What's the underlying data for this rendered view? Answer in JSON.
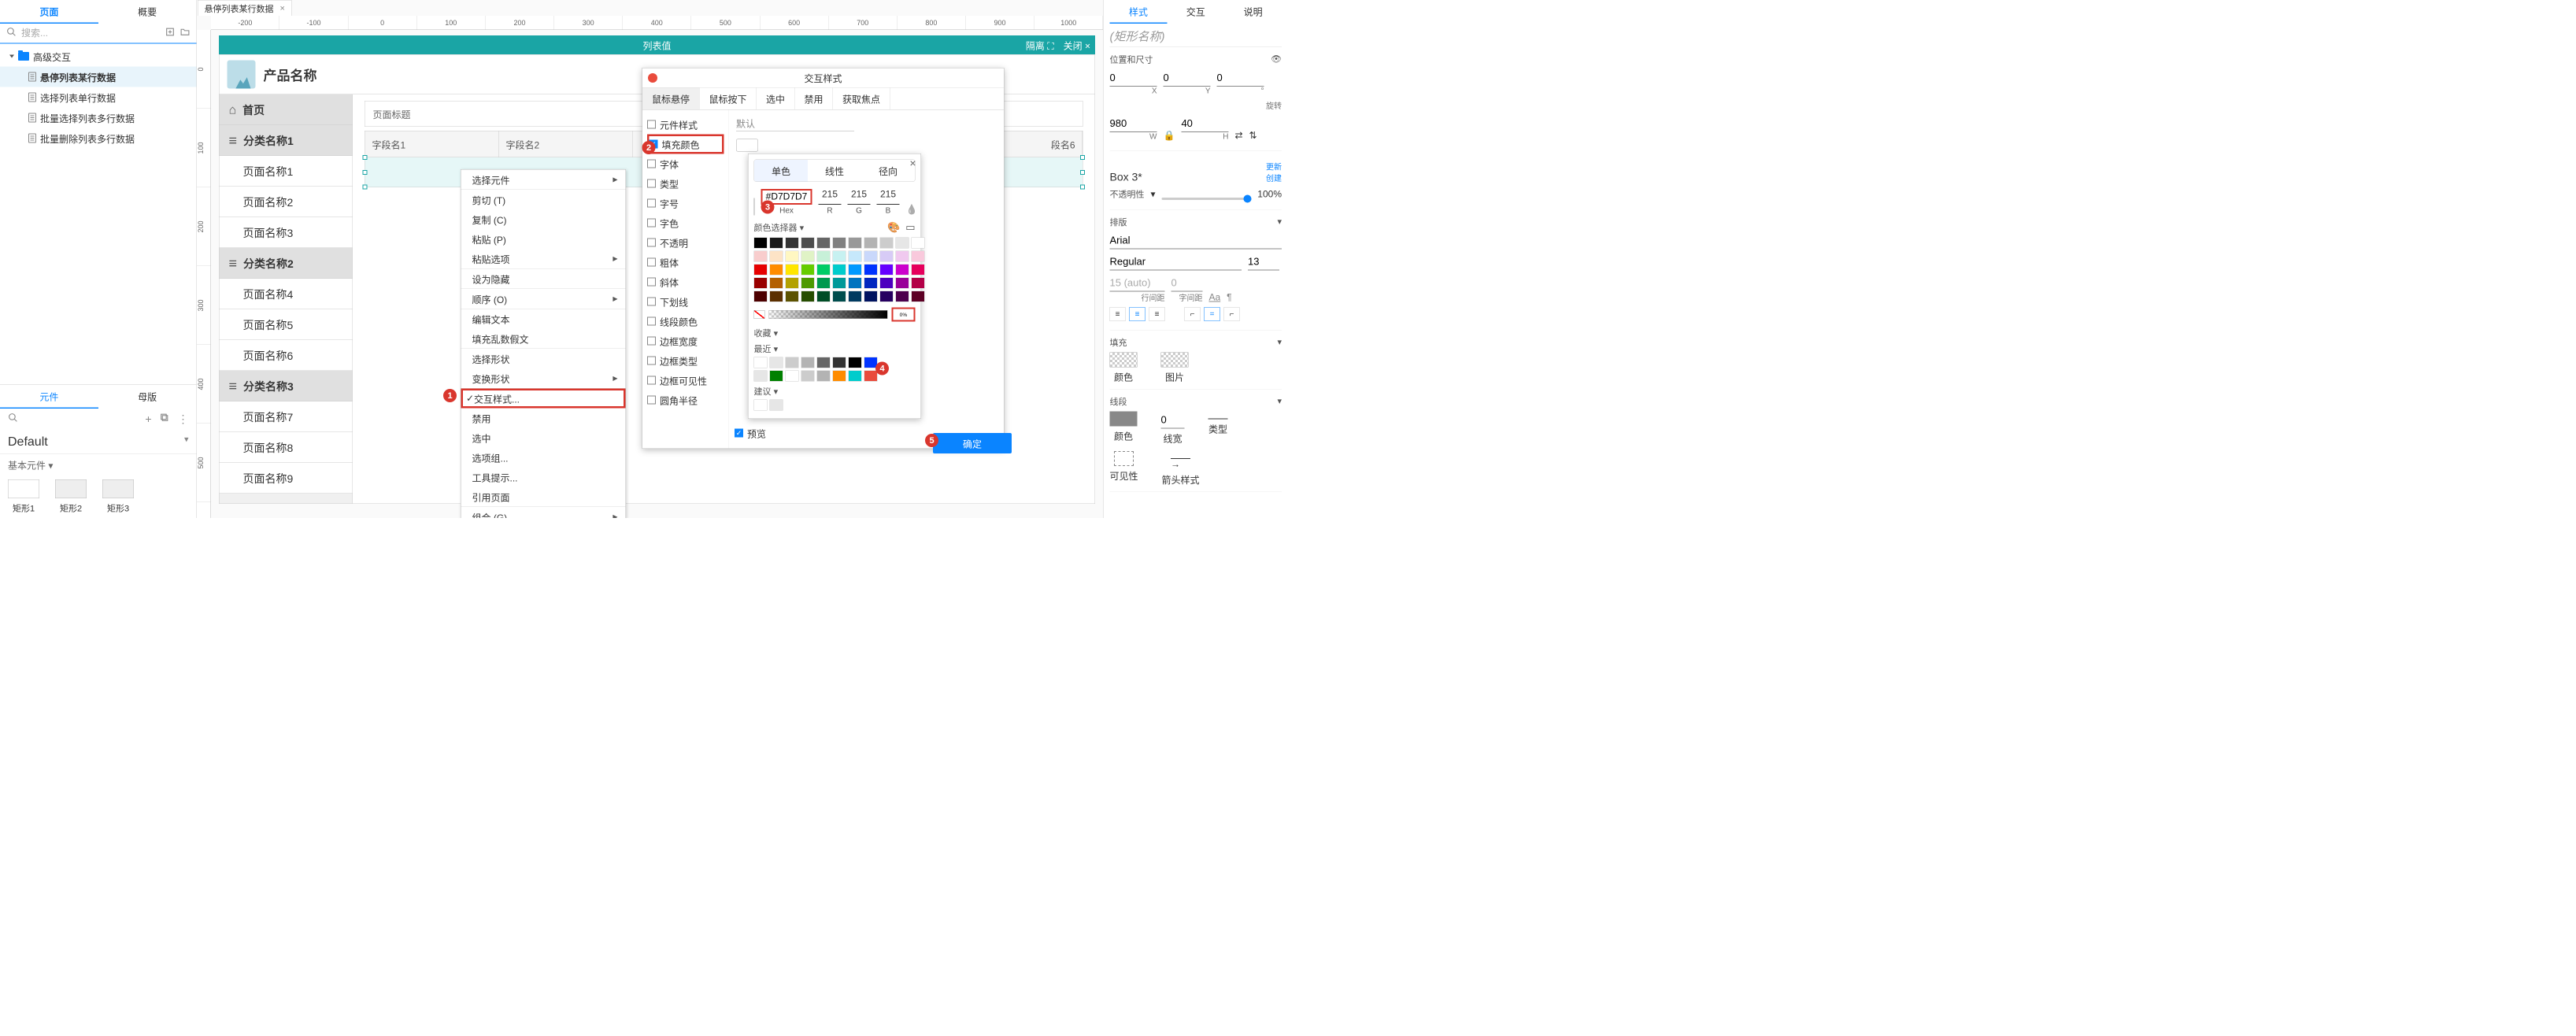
{
  "left": {
    "tabs": [
      "页面",
      "概要"
    ],
    "search_placeholder": "搜索...",
    "tree_root": "高级交互",
    "tree_items": [
      "悬停列表某行数据",
      "选择列表单行数据",
      "批量选择列表多行数据",
      "批量删除列表多行数据"
    ],
    "bot_tabs": [
      "元件",
      "母版"
    ],
    "default": "Default",
    "basic_section": "基本元件",
    "shapes": [
      "矩形1",
      "矩形2",
      "矩形3"
    ]
  },
  "canvas": {
    "doc_tab": "悬停列表某行数据",
    "ruler_h": [
      "-200",
      "-100",
      "0",
      "100",
      "200",
      "300",
      "400",
      "500",
      "600",
      "700",
      "800",
      "900",
      "1000"
    ],
    "ruler_v": [
      "0",
      "100",
      "200",
      "300",
      "400",
      "500"
    ],
    "title": "列表值",
    "isolate": "隔离",
    "close": "关闭",
    "product": "产品名称",
    "side": [
      "首页",
      "分类名称1",
      "页面名称1",
      "页面名称2",
      "页面名称3",
      "分类名称2",
      "页面名称4",
      "页面名称5",
      "页面名称6",
      "分类名称3",
      "页面名称7",
      "页面名称8",
      "页面名称9"
    ],
    "side_cat_idx": [
      0,
      1,
      5,
      9
    ],
    "main_title": "页面标题",
    "cols": [
      "字段名1",
      "字段名2",
      "段名6"
    ]
  },
  "ctx": [
    {
      "t": "选择元件",
      "sub": true
    },
    {
      "sep": true
    },
    {
      "t": "剪切 (T)"
    },
    {
      "t": "复制 (C)"
    },
    {
      "t": "粘贴 (P)"
    },
    {
      "t": "粘贴选项",
      "sub": true
    },
    {
      "sep": true
    },
    {
      "t": "设为隐藏"
    },
    {
      "sep": true
    },
    {
      "t": "顺序 (O)",
      "sub": true
    },
    {
      "sep": true
    },
    {
      "t": "编辑文本"
    },
    {
      "t": "填充乱数假文"
    },
    {
      "sep": true
    },
    {
      "t": "选择形状"
    },
    {
      "t": "变换形状",
      "sub": true
    },
    {
      "sep": true
    },
    {
      "t": "交互样式...",
      "check": true,
      "hl": true
    },
    {
      "t": "禁用"
    },
    {
      "t": "选中"
    },
    {
      "t": "选项组..."
    },
    {
      "t": "工具提示..."
    },
    {
      "t": "引用页面"
    },
    {
      "sep": true
    },
    {
      "t": "组合 (G)",
      "sub": true
    }
  ],
  "ixdlg": {
    "title": "交互样式",
    "tabs": [
      "鼠标悬停",
      "鼠标按下",
      "选中",
      "禁用",
      "获取焦点"
    ],
    "opts": [
      "元件样式",
      "填充颜色",
      "字体",
      "类型",
      "字号",
      "字色",
      "不透明",
      "粗体",
      "斜体",
      "下划线",
      "线段颜色",
      "边框宽度",
      "边框类型",
      "边框可见性",
      "圆角半径"
    ],
    "checked_idx": 1,
    "default": "默认",
    "preview": "预览",
    "ok": "确定"
  },
  "cpk": {
    "tabs": [
      "单色",
      "线性",
      "径向"
    ],
    "hex": "#D7D7D7",
    "r": "215",
    "g": "215",
    "b": "215",
    "hex_l": "Hex",
    "r_l": "R",
    "g_l": "G",
    "b_l": "B",
    "picker": "颜色选择器",
    "opacity": "0%",
    "fav": "收藏",
    "recent": "最近",
    "suggest": "建议",
    "grays": [
      "#000000",
      "#1a1a1a",
      "#333333",
      "#4d4d4d",
      "#666666",
      "#808080",
      "#999999",
      "#b3b3b3",
      "#cccccc",
      "#e6e6e6",
      "#ffffff"
    ],
    "row1": [
      "#f8cdcd",
      "#fde3c6",
      "#fff7c2",
      "#e0f3c6",
      "#c7f0d8",
      "#c7f1f1",
      "#c6e8fb",
      "#c9d8fb",
      "#d7cbf6",
      "#f0c9ef",
      "#f9c9dc"
    ],
    "row2": [
      "#e60000",
      "#ff8c00",
      "#ffe600",
      "#66cc00",
      "#00cc66",
      "#00cccc",
      "#0099ff",
      "#0033ff",
      "#6600ff",
      "#cc00cc",
      "#e6005c"
    ],
    "row3": [
      "#990000",
      "#b35f00",
      "#b3a100",
      "#4d9900",
      "#00994d",
      "#009999",
      "#0073bf",
      "#0026bf",
      "#4d00bf",
      "#990099",
      "#b30047"
    ],
    "row4": [
      "#4d0000",
      "#5c3000",
      "#5c5200",
      "#264d00",
      "#004d26",
      "#004d4d",
      "#003a60",
      "#001360",
      "#260060",
      "#4d004d",
      "#5c0024"
    ],
    "recent_c": [
      "#ffffff",
      "#e6e6e6",
      "#cccccc",
      "#b3b3b3",
      "#666666",
      "#333333",
      "#000000",
      "#0033ff"
    ],
    "recent_c2": [
      "#e6e6e6",
      "#008000",
      "#ffffff",
      "#cccccc",
      "#b3b3b3",
      "#ff8c00",
      "#00cccc",
      "#e94b3c"
    ],
    "suggest_c": [
      "#ffffff",
      "#e6e6e6"
    ]
  },
  "right": {
    "tabs": [
      "样式",
      "交互",
      "说明"
    ],
    "name_ph": "(矩形名称)",
    "pos": "位置和尺寸",
    "x": "0",
    "y": "0",
    "rot": "0",
    "rot_l": "旋转",
    "w": "980",
    "h": "40",
    "box": "Box 3*",
    "update": "更新",
    "create": "创建",
    "opacity_l": "不透明性",
    "opacity": "100%",
    "layout": "排版",
    "font": "Arial",
    "weight": "Regular",
    "size": "13",
    "lh": "15 (auto)",
    "ls": "0",
    "lh_l": "行间距",
    "ls_l": "字间距",
    "fill_l": "填充",
    "fill_color": "颜色",
    "fill_img": "图片",
    "stroke_l": "线段",
    "stroke_color": "颜色",
    "stroke_w": "0",
    "stroke_wl": "线宽",
    "stroke_type": "类型",
    "vis": "可见性",
    "arrow": "箭头样式"
  },
  "badges": {
    "b1": "1",
    "b2": "2",
    "b3": "3",
    "b4": "4",
    "b5": "5"
  }
}
